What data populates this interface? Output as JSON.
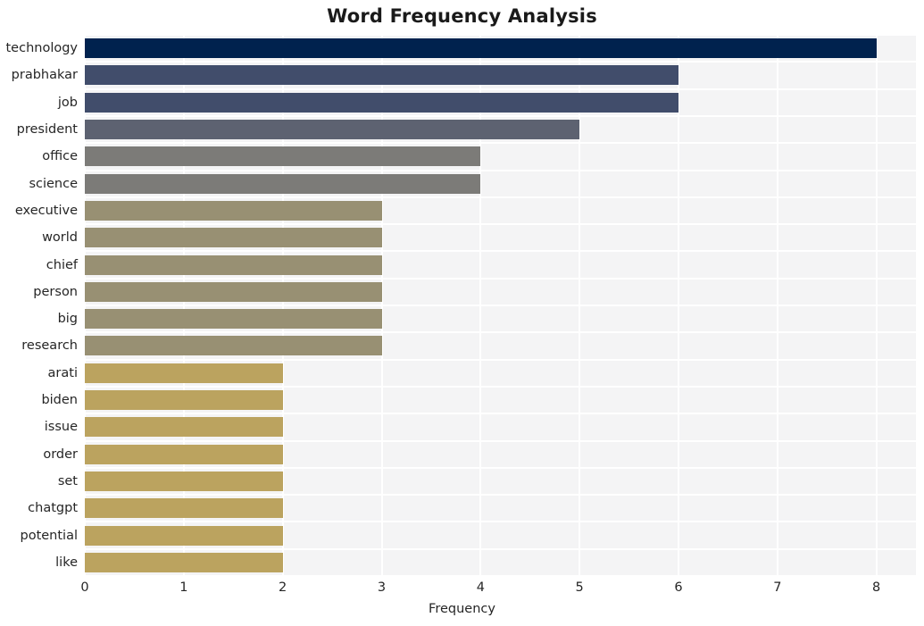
{
  "chart_data": {
    "type": "bar",
    "orientation": "horizontal",
    "title": "Word Frequency Analysis",
    "xlabel": "Frequency",
    "ylabel": "",
    "categories": [
      "technology",
      "prabhakar",
      "job",
      "president",
      "office",
      "science",
      "executive",
      "world",
      "chief",
      "person",
      "big",
      "research",
      "arati",
      "biden",
      "issue",
      "order",
      "set",
      "chatgpt",
      "potential",
      "like"
    ],
    "values": [
      8,
      6,
      6,
      5,
      4,
      4,
      3,
      3,
      3,
      3,
      3,
      3,
      2,
      2,
      2,
      2,
      2,
      2,
      2,
      2
    ],
    "bar_colors": [
      "#00224e",
      "#414d6b",
      "#414d6b",
      "#5d6271",
      "#7c7b78",
      "#7c7b78",
      "#989073",
      "#989073",
      "#989073",
      "#989073",
      "#989073",
      "#989073",
      "#bba35f",
      "#bba35f",
      "#bba35f",
      "#bba35f",
      "#bba35f",
      "#bba35f",
      "#bba35f",
      "#bba35f"
    ],
    "xticks": [
      "0",
      "1",
      "2",
      "3",
      "4",
      "5",
      "6",
      "7",
      "8"
    ],
    "xlim": [
      0,
      8.4
    ],
    "grid": true,
    "legend": false,
    "plot_background": "#f4f4f5",
    "gridline_color": "#ffffff",
    "colormap": "cividis"
  }
}
